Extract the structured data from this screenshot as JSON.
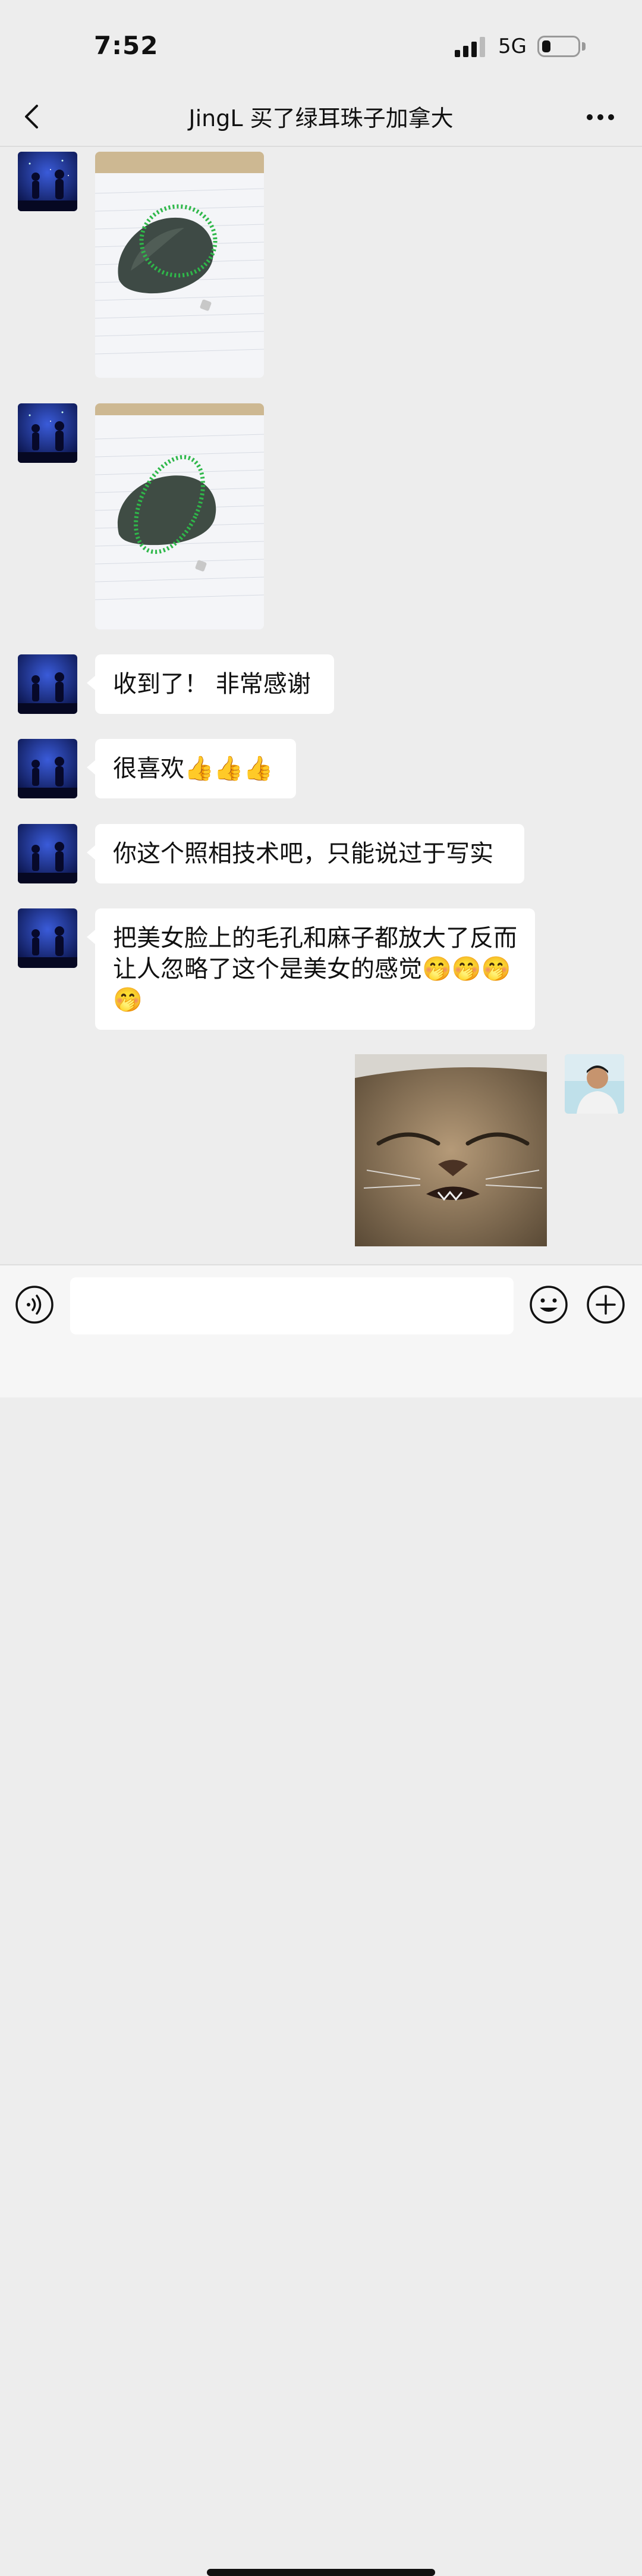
{
  "status_bar": {
    "time": "7:52",
    "network": "5G"
  },
  "header": {
    "title": "JingL 买了绿耳珠子加拿大"
  },
  "messages": [
    {
      "type": "image",
      "sender": "other",
      "content": "photo-green-bead-bracelet-on-stone"
    },
    {
      "type": "image",
      "sender": "other",
      "content": "photo-green-bead-bracelet-on-stone"
    },
    {
      "type": "text",
      "sender": "other",
      "text": "收到了！ 非常感谢"
    },
    {
      "type": "text",
      "sender": "other",
      "text": "很喜欢👍👍👍"
    },
    {
      "type": "text",
      "sender": "other",
      "text": "你这个照相技术吧，只能说过于写实"
    },
    {
      "type": "text",
      "sender": "other",
      "text": "把美女脸上的毛孔和麻子都放大了反而让人忽略了这个是美女的感觉🤭🤭🤭🤭"
    },
    {
      "type": "sticker",
      "sender": "self",
      "content": "squinting-cat-sticker"
    }
  ],
  "input_bar": {
    "placeholder": ""
  },
  "colors": {
    "background": "#ededed",
    "bubble": "#ffffff",
    "input_bar": "#f6f6f6"
  }
}
